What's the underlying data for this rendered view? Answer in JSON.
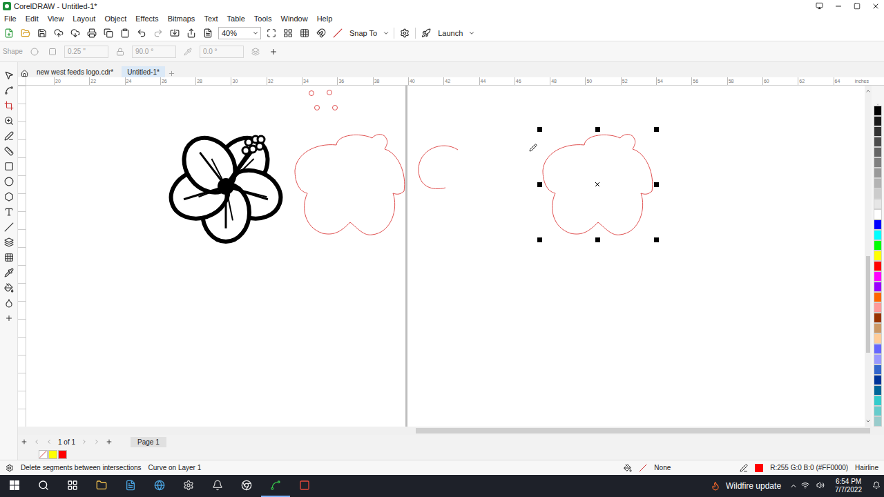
{
  "window": {
    "title": "CorelDRAW - Untitled-1*"
  },
  "menu": [
    "File",
    "Edit",
    "View",
    "Layout",
    "Object",
    "Effects",
    "Bitmaps",
    "Text",
    "Table",
    "Tools",
    "Window",
    "Help"
  ],
  "toolbar": {
    "zoom": "40%",
    "snap": "Snap To",
    "launch": "Launch"
  },
  "property_bar": {
    "shape_label": "Shape",
    "outline_width": "0.25 \"",
    "angle": "90.0 °",
    "rotation": "0.0 °",
    "disabled": true
  },
  "doc_tabs": [
    {
      "label": "new west feeds logo.cdr*",
      "selected": false
    },
    {
      "label": "Untitled-1*",
      "selected": true
    }
  ],
  "ruler": {
    "ticks": [
      "20",
      "22",
      "24",
      "26",
      "28",
      "30",
      "32",
      "34",
      "36",
      "38",
      "40",
      "42",
      "44",
      "46",
      "48",
      "50",
      "52",
      "54",
      "56",
      "58",
      "60",
      "62",
      "64"
    ],
    "unit": "inches"
  },
  "page_nav": {
    "count": "1 of 1",
    "page": "Page 1"
  },
  "document_palette": [
    {
      "kind": "none",
      "color": "#ffffff"
    },
    {
      "kind": "swatch",
      "color": "#ffff00"
    },
    {
      "kind": "swatch",
      "color": "#ff0000"
    }
  ],
  "color_palette": [
    {
      "color": "#000000"
    },
    {
      "color": "#1a1a1a"
    },
    {
      "color": "#333333"
    },
    {
      "color": "#4d4d4d"
    },
    {
      "color": "#666666"
    },
    {
      "color": "#808080"
    },
    {
      "color": "#999999"
    },
    {
      "color": "#b3b3b3"
    },
    {
      "color": "#cccccc"
    },
    {
      "color": "#e6e6e6"
    },
    {
      "color": "#ffffff"
    },
    {
      "color": "#0000ff"
    },
    {
      "color": "#00ffff"
    },
    {
      "color": "#00ff00"
    },
    {
      "color": "#ffff00"
    },
    {
      "color": "#ff0000"
    },
    {
      "color": "#ff00ff"
    },
    {
      "color": "#9900ff"
    },
    {
      "color": "#ff6600"
    },
    {
      "color": "#ff9999"
    },
    {
      "color": "#993300"
    },
    {
      "color": "#cc9966"
    },
    {
      "color": "#ffcc99"
    },
    {
      "color": "#6666ff"
    },
    {
      "color": "#9999ff"
    },
    {
      "color": "#3366cc"
    },
    {
      "color": "#003399"
    },
    {
      "color": "#006699"
    },
    {
      "color": "#33cccc"
    },
    {
      "color": "#66cccc"
    },
    {
      "color": "#99cccc"
    }
  ],
  "status_bar": {
    "hint": "Delete segments between intersections",
    "object": "Curve on Layer 1",
    "fill": "None",
    "outline_color": "R:255 G:0 B:0 (#FF0000)",
    "outline_swatch": "#ff0000",
    "outline_width": "Hairline"
  },
  "taskbar": {
    "notification": "Wildfire update",
    "time": "6:54 PM",
    "date": "7/7/2022"
  }
}
